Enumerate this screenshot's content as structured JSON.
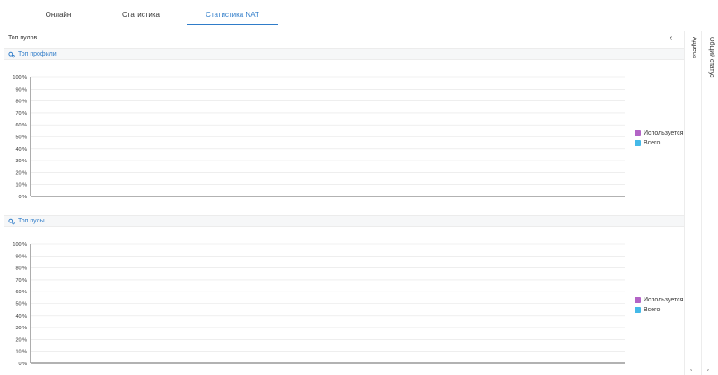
{
  "tabs": [
    {
      "label": "Онлайн"
    },
    {
      "label": "Статистика"
    },
    {
      "label": "Статистика NAT",
      "active": true
    }
  ],
  "panel": {
    "title": "Топ пулов",
    "collapse_icon": "chevron-left-icon"
  },
  "sections": [
    {
      "title": "Топ профили",
      "icon": "gears-icon"
    },
    {
      "title": "Топ пулы",
      "icon": "gears-icon"
    }
  ],
  "legend": [
    {
      "label": "Используется",
      "color": "#b364c6"
    },
    {
      "label": "Всего",
      "color": "#45b9e8"
    }
  ],
  "side": {
    "addresses": "Адреса",
    "status": "Общий статус"
  },
  "chart_data": [
    {
      "type": "bar",
      "title": "Топ профили",
      "categories": [],
      "series": [
        {
          "name": "Используется",
          "values": []
        },
        {
          "name": "Всего",
          "values": []
        }
      ],
      "y_ticks": [
        "100 %",
        "90 %",
        "80 %",
        "70 %",
        "60 %",
        "50 %",
        "40 %",
        "30 %",
        "20 %",
        "10 %",
        "0 %"
      ],
      "ylim": [
        0,
        100
      ],
      "grid": true,
      "legend": "right"
    },
    {
      "type": "bar",
      "title": "Топ пулы",
      "categories": [],
      "series": [
        {
          "name": "Используется",
          "values": []
        },
        {
          "name": "Всего",
          "values": []
        }
      ],
      "y_ticks": [
        "100 %",
        "90 %",
        "80 %",
        "70 %",
        "60 %",
        "50 %",
        "40 %",
        "30 %",
        "20 %",
        "10 %",
        "0 %"
      ],
      "ylim": [
        0,
        100
      ],
      "grid": true,
      "legend": "right"
    }
  ]
}
